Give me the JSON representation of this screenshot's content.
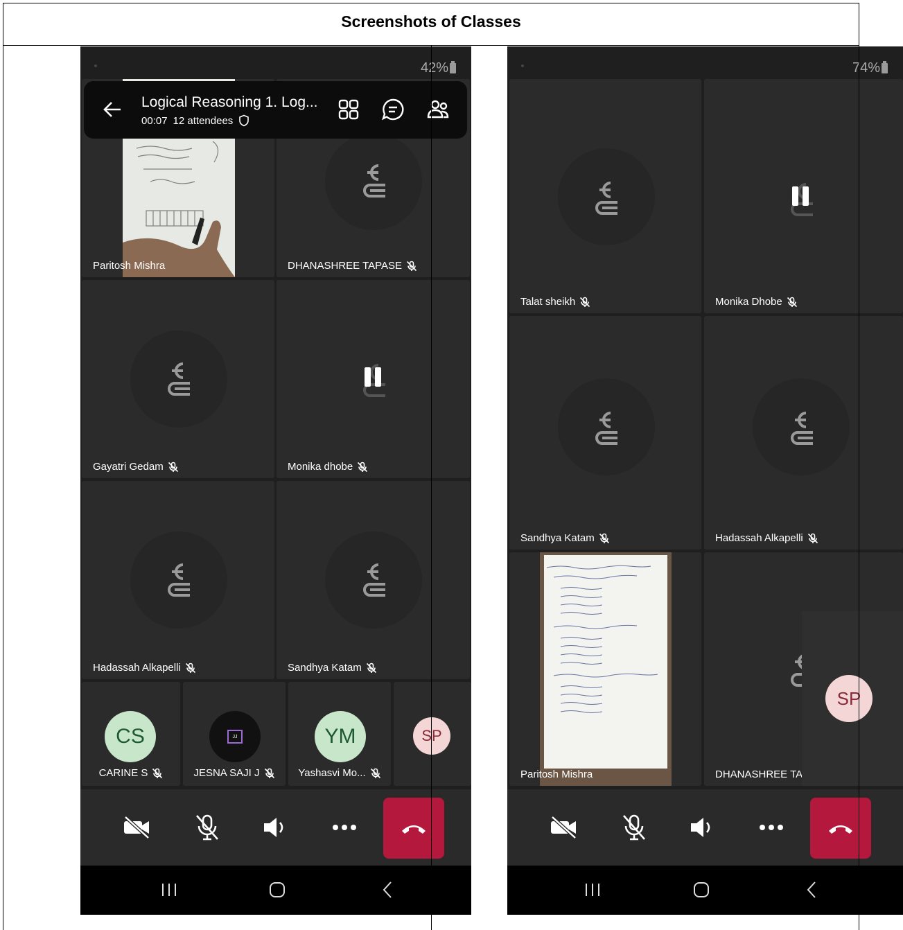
{
  "document": {
    "title": "Screenshots of Classes"
  },
  "phone1": {
    "battery": "42%",
    "meeting": {
      "title": "Logical Reasoning 1. Log...",
      "timer": "00:07",
      "attendees": "12 attendees"
    },
    "tiles": [
      {
        "name": "Paritosh Mishra"
      },
      {
        "name": "DHANASHREE TAPASE"
      },
      {
        "name": "Gayatri Gedam"
      },
      {
        "name": "Monika dhobe"
      },
      {
        "name": "Hadassah Alkapelli"
      },
      {
        "name": "Sandhya Katam"
      }
    ],
    "small_tiles": [
      {
        "initials": "CS",
        "name": "CARINE S"
      },
      {
        "initials": "JJ",
        "name": "JESNA SAJI J"
      },
      {
        "initials": "YM",
        "name": "Yashasvi Mo..."
      },
      {
        "initials": "SP",
        "name": ""
      }
    ]
  },
  "phone2": {
    "battery": "74%",
    "tiles": [
      {
        "name": "Talat sheikh"
      },
      {
        "name": "Monika Dhobe"
      },
      {
        "name": "Sandhya Katam"
      },
      {
        "name": "Hadassah Alkapelli"
      },
      {
        "name": "Paritosh Mishra"
      },
      {
        "name": "DHANASHREE TA"
      }
    ],
    "self_initials": "SP"
  },
  "colors": {
    "background": "#1f1f1f",
    "tile": "#2b2b2b",
    "hangup": "#b4183c",
    "cs_avatar": "#c8e6c9",
    "ym_avatar": "#c8e6c9",
    "sp_avatar": "#f4d6d6"
  }
}
